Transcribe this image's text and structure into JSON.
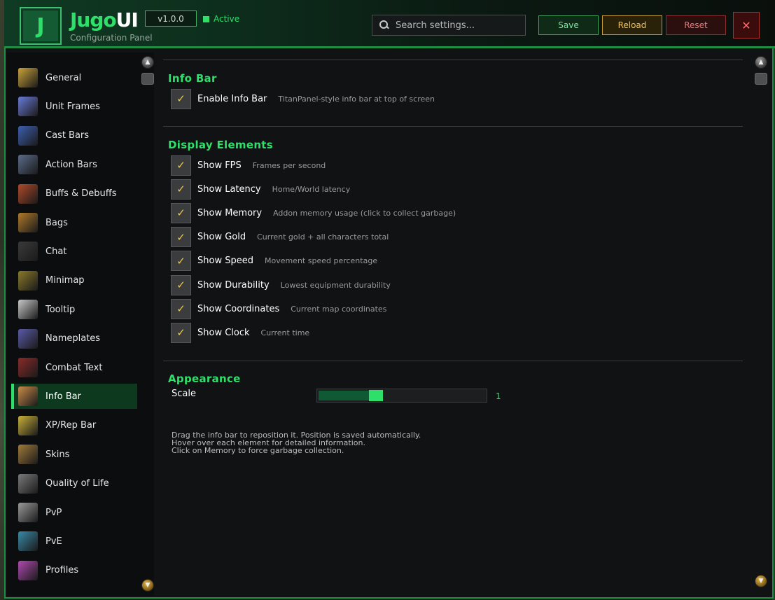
{
  "app": {
    "logo_letter": "J",
    "title_part1": "Jugo",
    "title_part2": "UI",
    "subtitle": "Configuration Panel",
    "version": "v1.0.0",
    "status": "Active"
  },
  "search": {
    "placeholder": "Search settings..."
  },
  "buttons": {
    "save": "Save",
    "reload": "Reload",
    "reset": "Reset",
    "close": "✕"
  },
  "sidebar": {
    "items": [
      {
        "label": "General",
        "icon": "gear-icon",
        "color": "#c9a23a"
      },
      {
        "label": "Unit Frames",
        "icon": "sparkle-icon",
        "color": "#6a7bd8"
      },
      {
        "label": "Cast Bars",
        "icon": "orb-icon",
        "color": "#3d5fb0"
      },
      {
        "label": "Action Bars",
        "icon": "hammer-icon",
        "color": "#5a6c8a"
      },
      {
        "label": "Buffs & Debuffs",
        "icon": "potion-icon",
        "color": "#b04a2a"
      },
      {
        "label": "Bags",
        "icon": "bag-icon",
        "color": "#b07a2a"
      },
      {
        "label": "Chat",
        "icon": "chat-icon",
        "color": "#3a3a3a"
      },
      {
        "label": "Minimap",
        "icon": "map-icon",
        "color": "#8a7a2a"
      },
      {
        "label": "Tooltip",
        "icon": "scroll-icon",
        "color": "#c8c8c8"
      },
      {
        "label": "Nameplates",
        "icon": "sword-icon",
        "color": "#5a5aa8"
      },
      {
        "label": "Combat Text",
        "icon": "text-icon",
        "color": "#8a2a2a"
      },
      {
        "label": "Info Bar",
        "icon": "info-scroll-icon",
        "color": "#c88a4a",
        "active": true
      },
      {
        "label": "XP/Rep Bar",
        "icon": "wings-icon",
        "color": "#c8b03a"
      },
      {
        "label": "Skins",
        "icon": "crate-icon",
        "color": "#a07a3a"
      },
      {
        "label": "Quality of Life",
        "icon": "cog-icon",
        "color": "#7a7a7a"
      },
      {
        "label": "PvP",
        "icon": "crossed-swords-icon",
        "color": "#9a9a9a"
      },
      {
        "label": "PvE",
        "icon": "helm-icon",
        "color": "#3a8aa8"
      },
      {
        "label": "Profiles",
        "icon": "profile-icon",
        "color": "#b04ab0"
      }
    ]
  },
  "content": {
    "section_info": {
      "title": "Info Bar",
      "options": [
        {
          "label": "Enable Info Bar",
          "desc": "TitanPanel-style info bar at top of screen",
          "checked": true
        }
      ]
    },
    "section_display": {
      "title": "Display Elements",
      "options": [
        {
          "label": "Show FPS",
          "desc": "Frames per second",
          "checked": true
        },
        {
          "label": "Show Latency",
          "desc": "Home/World latency",
          "checked": true
        },
        {
          "label": "Show Memory",
          "desc": "Addon memory usage (click to collect garbage)",
          "checked": true
        },
        {
          "label": "Show Gold",
          "desc": "Current gold + all characters total",
          "checked": true
        },
        {
          "label": "Show Speed",
          "desc": "Movement speed percentage",
          "checked": true
        },
        {
          "label": "Show Durability",
          "desc": "Lowest equipment durability",
          "checked": true
        },
        {
          "label": "Show Coordinates",
          "desc": "Current map coordinates",
          "checked": true
        },
        {
          "label": "Show Clock",
          "desc": "Current time",
          "checked": true
        }
      ]
    },
    "section_appearance": {
      "title": "Appearance",
      "scale_label": "Scale",
      "scale_value": "1",
      "scale_fraction": 0.35
    },
    "help_lines": [
      "Drag the info bar to reposition it. Position is saved automatically.",
      "Hover over each element for detailed information.",
      "Click on Memory to force garbage collection."
    ]
  },
  "colors": {
    "accent": "#2ee06a",
    "check": "#f2c744",
    "panel_border": "#1f8e45"
  }
}
